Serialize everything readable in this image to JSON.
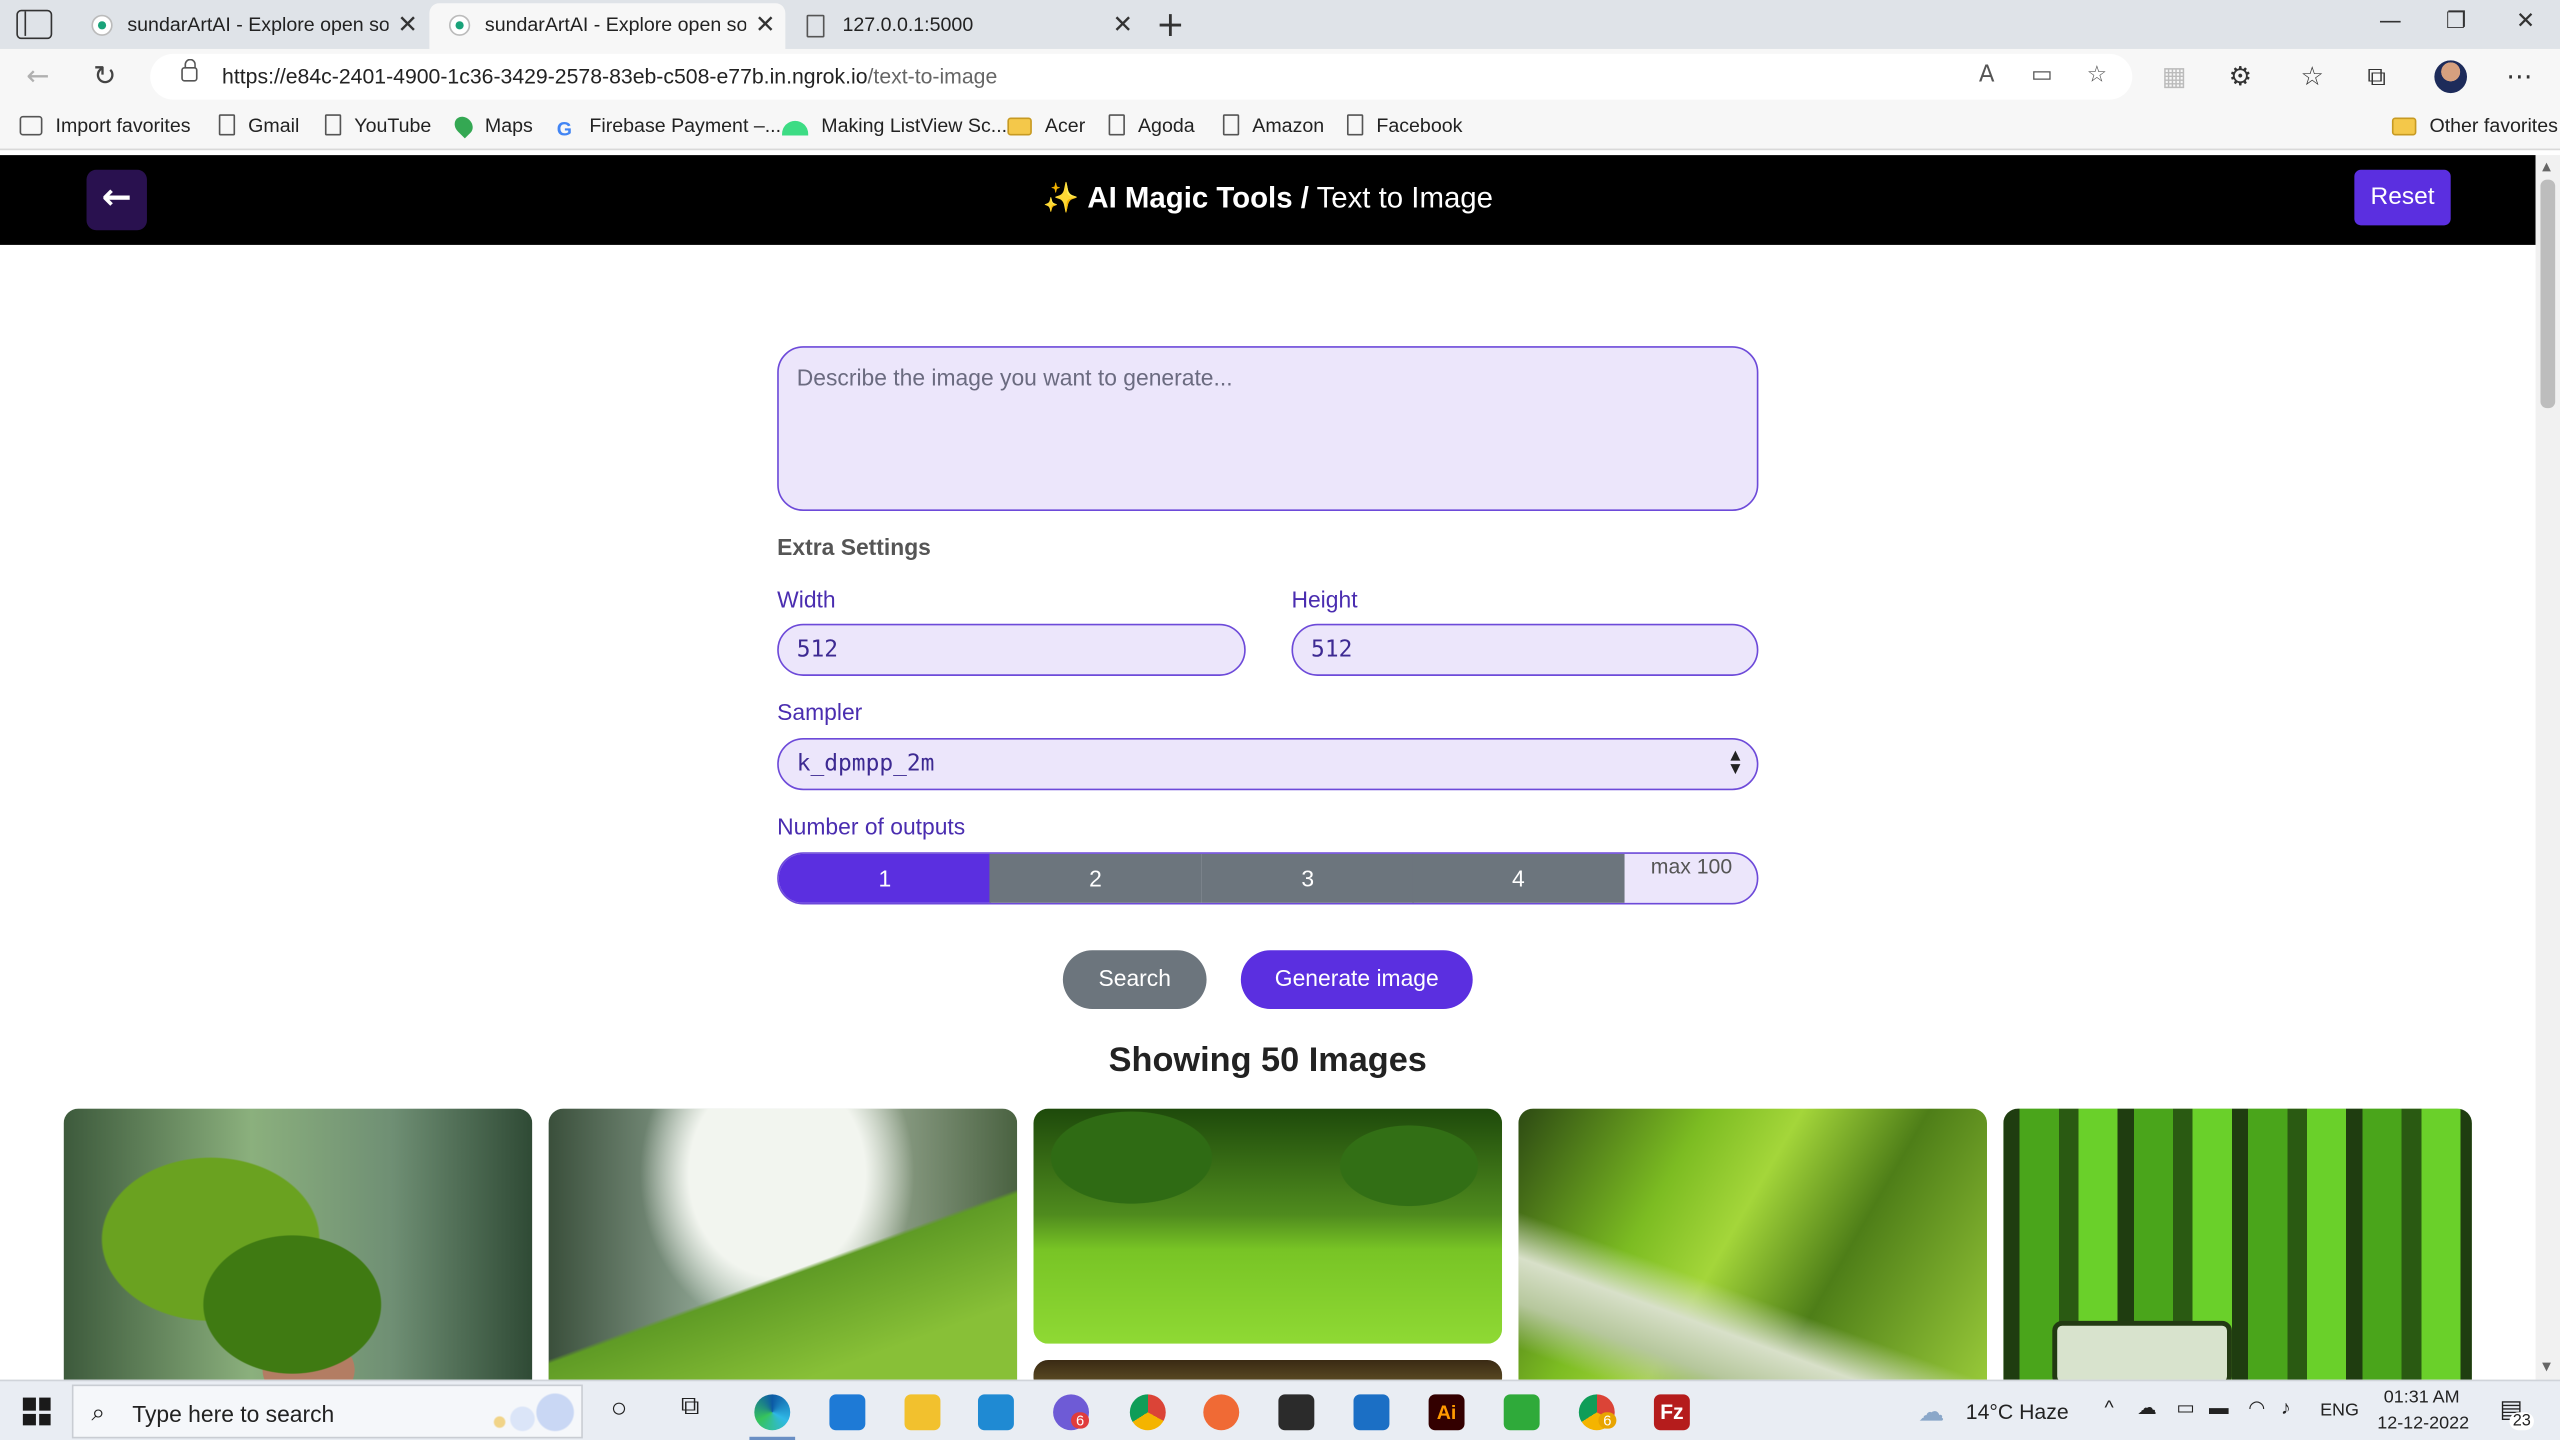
{
  "browser": {
    "tabs": [
      {
        "title": "sundarArtAI - Explore open source",
        "close": "✕"
      },
      {
        "title": "sundarArtAI - Explore open source",
        "close": "✕"
      },
      {
        "title": "127.0.0.1:5000",
        "close": "✕"
      }
    ],
    "new_tab": "+",
    "url_host": "https://e84c-2401-4900-1c36-3429-2578-83eb-c508-e77b.in.ngrok.io",
    "url_path": "/text-to-image",
    "favorites": [
      {
        "label": "Import favorites",
        "icon": "import-icon"
      },
      {
        "label": "Gmail",
        "icon": "page-icon"
      },
      {
        "label": "YouTube",
        "icon": "page-icon"
      },
      {
        "label": "Maps",
        "icon": "maps-icon"
      },
      {
        "label": "Firebase Payment –...",
        "icon": "google-icon"
      },
      {
        "label": "Making ListView Sc...",
        "icon": "android-icon"
      },
      {
        "label": "Acer",
        "icon": "folder-icon"
      },
      {
        "label": "Agoda",
        "icon": "page-icon"
      },
      {
        "label": "Amazon",
        "icon": "page-icon"
      },
      {
        "label": "Facebook",
        "icon": "page-icon"
      }
    ],
    "other_favorites": "Other favorites"
  },
  "header": {
    "icon": "magic-wand-icon",
    "title_bold": "AI Magic Tools /",
    "title_rest": "Text to Image",
    "reset_label": "Reset",
    "back_icon": "arrow-left-icon"
  },
  "form": {
    "prompt_placeholder": "Describe the image you want to generate...",
    "prompt_value": "",
    "extra_settings": "Extra Settings",
    "width_label": "Width",
    "width_value": "512",
    "height_label": "Height",
    "height_value": "512",
    "sampler_label": "Sampler",
    "sampler_value": "k_dpmpp_2m",
    "outputs_label": "Number of outputs",
    "outputs_options": [
      "1",
      "2",
      "3",
      "4"
    ],
    "outputs_selected": "1",
    "outputs_max": "max 100",
    "search_label": "Search",
    "generate_label": "Generate image"
  },
  "gallery": {
    "heading": "Showing 50 Images"
  },
  "taskbar": {
    "search_placeholder": "Type here to search",
    "weather": "14°C  Haze",
    "language": "ENG",
    "time": "01:31 AM",
    "date": "12-12-2022",
    "notifications": "23",
    "chrome_badge": "6",
    "app_badge": "6"
  },
  "colors": {
    "accent": "#5b2fe0",
    "field_bg": "#ece6fb",
    "secondary": "#6c757d",
    "header_bg": "#000000"
  }
}
